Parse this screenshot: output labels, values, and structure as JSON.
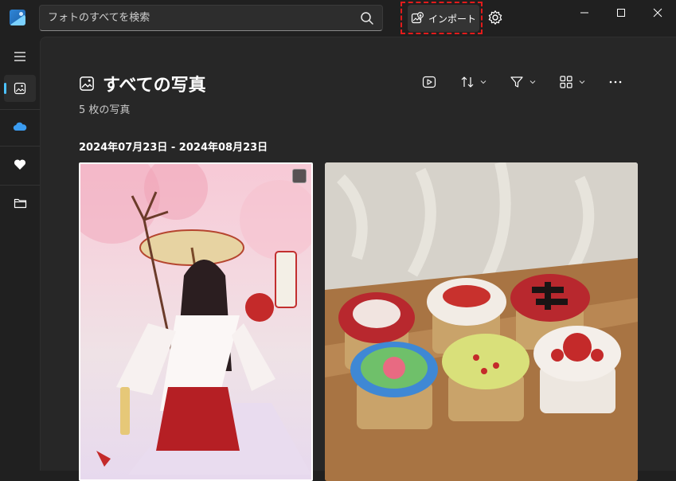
{
  "search": {
    "placeholder": "フォトのすべてを検索"
  },
  "header": {
    "import_label": "インポート"
  },
  "page": {
    "title": "すべての写真",
    "count": "5 枚の写真",
    "date_range": "2024年07月23日 - 2024年08月23日"
  },
  "colors": {
    "accent": "#4cc2ff",
    "highlight_border": "#e21b1b",
    "background": "#202020",
    "content_background": "#272727"
  },
  "sidebar": {
    "items": [
      {
        "name": "menu",
        "icon": "hamburger-icon"
      },
      {
        "name": "all-photos",
        "icon": "photos-icon",
        "active": true
      },
      {
        "name": "onedrive",
        "icon": "cloud-icon"
      },
      {
        "name": "favorites",
        "icon": "heart-icon"
      },
      {
        "name": "folders",
        "icon": "folder-icon"
      }
    ]
  },
  "toolbar": {
    "buttons": [
      {
        "name": "slideshow",
        "icon": "play-icon"
      },
      {
        "name": "sort",
        "icon": "sort-icon"
      },
      {
        "name": "filter",
        "icon": "filter-icon"
      },
      {
        "name": "view",
        "icon": "grid-icon"
      },
      {
        "name": "more",
        "icon": "more-icon"
      }
    ]
  },
  "photos": [
    {
      "subject": "anime-shrine-maiden-illustration",
      "selected": true
    },
    {
      "subject": "decorated-cupcakes-on-table",
      "selected": false
    }
  ]
}
